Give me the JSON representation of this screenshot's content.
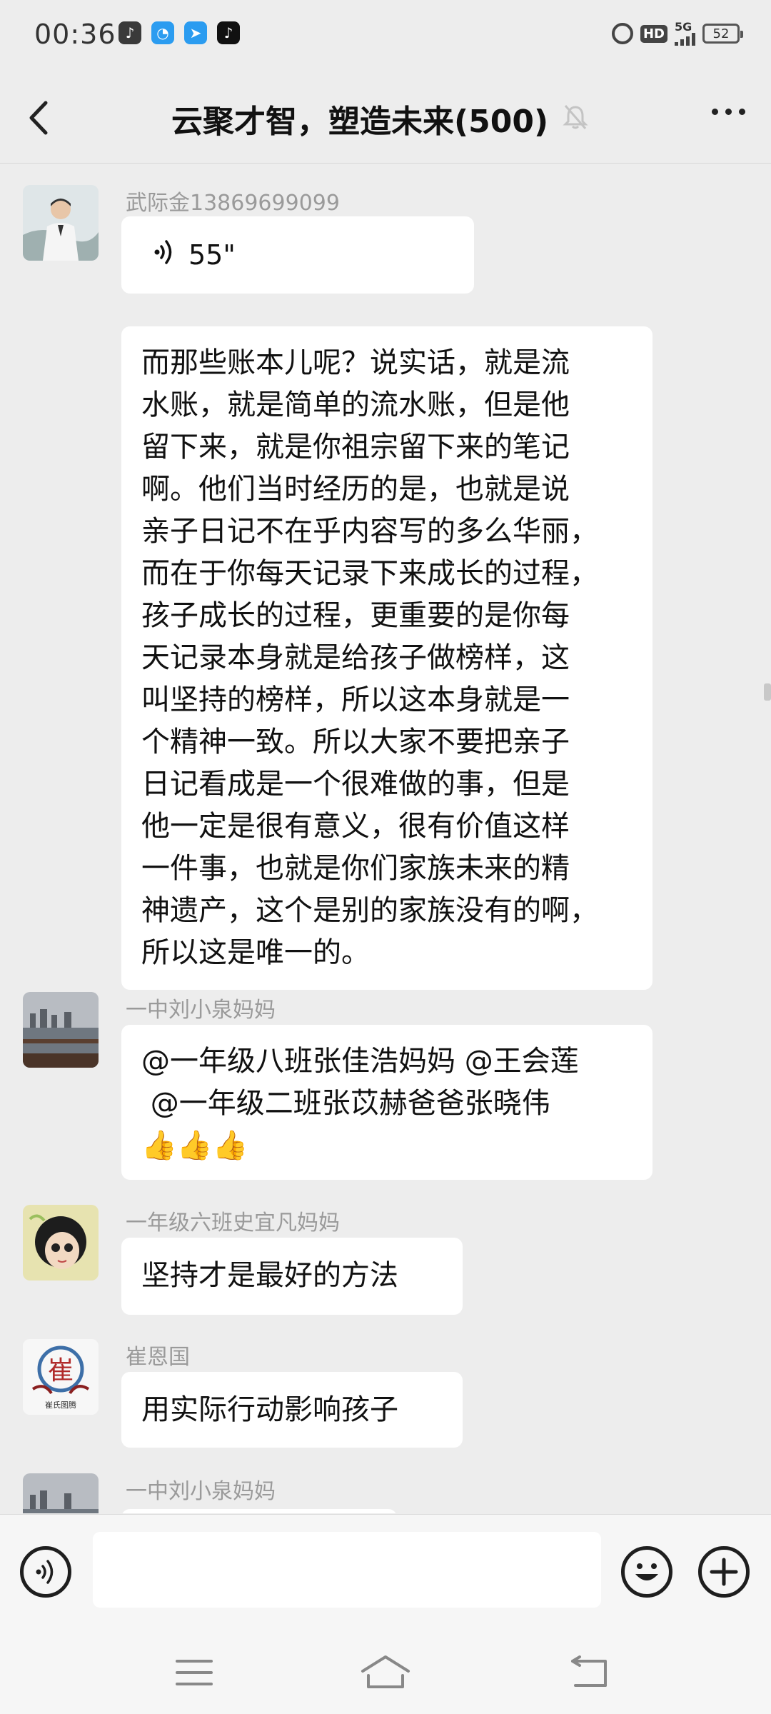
{
  "status_bar": {
    "time": "00:36",
    "hd_label": "HD",
    "network_label": "5G",
    "battery": "52",
    "notification_icons": [
      "music-note-icon",
      "browser-icon",
      "mail-send-icon",
      "tiktok-icon"
    ]
  },
  "nav": {
    "title": "云聚才智，塑造未来(500)",
    "back_icon": "chevron-left-icon",
    "mute_icon": "bell-muted-icon",
    "more_icon": "more-dots-icon"
  },
  "messages": [
    {
      "sender": "武际金13869699099",
      "voice_duration": "55\"",
      "text_lines": [
        "而那些账本儿呢？说实话，就是流",
        "水账，就是简单的流水账，但是他",
        "留下来，就是你祖宗留下来的笔记",
        "啊。他们当时经历的是，也就是说",
        "亲子日记不在乎内容写的多么华丽，",
        "而在于你每天记录下来成长的过程，",
        "孩子成长的过程，更重要的是你每",
        "天记录本身就是给孩子做榜样，这",
        "叫坚持的榜样，所以这本身就是一",
        "个精神一致。所以大家不要把亲子",
        "日记看成是一个很难做的事，但是",
        "他一定是很有意义，很有价值这样",
        "一件事，也就是你们家族未来的精",
        "神遗产，这个是别的家族没有的啊，",
        "所以这是唯一的。"
      ]
    },
    {
      "sender": "一中刘小泉妈妈",
      "text_lines": [
        "@一年级八班张佳浩妈妈 @王会莲",
        " @一年级二班张苡赫爸爸张晓伟"
      ],
      "emoji": "👍👍👍"
    },
    {
      "sender": "一年级六班史宜凡妈妈",
      "text": "坚持才是最好的方法"
    },
    {
      "sender": "崔恩国",
      "avatar_caption": "崔氏图腾",
      "text": "用实际行动影响孩子"
    },
    {
      "sender": "一中刘小泉妈妈"
    }
  ],
  "input_bar": {
    "voice_icon": "voice-input-icon",
    "emoji_icon": "emoji-smile-icon",
    "plus_icon": "plus-circle-icon",
    "placeholder": ""
  },
  "system_nav": {
    "menu_icon": "menu-lines-icon",
    "home_icon": "home-icon",
    "back_icon": "back-arrow-icon"
  }
}
